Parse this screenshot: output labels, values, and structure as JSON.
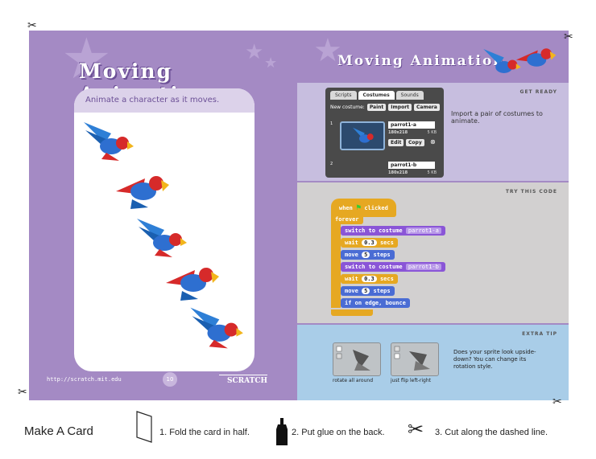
{
  "left_page": {
    "title": "Moving Animation",
    "panel_caption": "Animate a character as it moves.",
    "footer_url": "http://scratch.mit.edu",
    "page_number": "10",
    "footer_logo": "SCRATCH"
  },
  "right_page": {
    "title": "Moving Animation",
    "get_ready": {
      "label": "GET READY",
      "tabs": [
        "Scripts",
        "Costumes",
        "Sounds"
      ],
      "active_tab": "Costumes",
      "new_costume_label": "New costume:",
      "buttons": [
        "Paint",
        "Import",
        "Camera"
      ],
      "costumes": [
        {
          "index": "1",
          "name": "parrot1-a",
          "dims": "180x218",
          "size": "5 KB",
          "edit": "Edit",
          "copy": "Copy"
        },
        {
          "index": "2",
          "name": "parrot1-b",
          "dims": "180x218",
          "size": "5 KB"
        }
      ],
      "text": "Import a pair of costumes to animate."
    },
    "try_code": {
      "label": "TRY THIS CODE",
      "when_clicked": [
        "when",
        "clicked"
      ],
      "forever": "forever",
      "switch_label": "switch to costume",
      "costume_a": "parrot1-a",
      "costume_b": "parrot1-b",
      "wait": "wait",
      "secs": "secs",
      "wait_value": "0.3",
      "move": "move",
      "steps": "steps",
      "move_value": "5",
      "bounce": "if on edge, bounce"
    },
    "extra_tip": {
      "label": "EXTRA TIP",
      "text": "Does your sprite look upside-down? You can change its rotation style.",
      "caption_1": "rotate all around",
      "caption_2": "just flip left-right"
    }
  },
  "instructions": {
    "make_card": "Make A Card",
    "step1": "1. Fold the card in half.",
    "step2": "2. Put glue on the back.",
    "step3": "3. Cut along the dashed line."
  },
  "colors": {
    "purple_page": "#a48ac4",
    "block_control": "#e6a822",
    "block_motion": "#4a6cd4",
    "block_looks": "#8a55d7"
  }
}
